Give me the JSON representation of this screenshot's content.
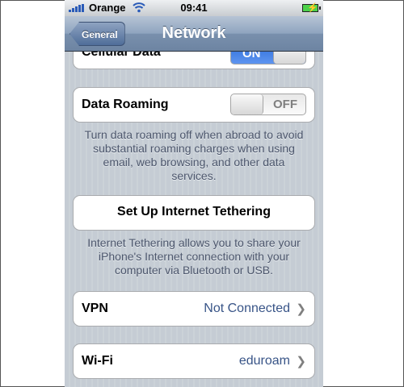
{
  "status": {
    "carrier": "Orange",
    "time": "09:41"
  },
  "nav": {
    "title": "Network",
    "back_label": "General"
  },
  "cellular": {
    "label": "Cellular Data",
    "toggle": "ON"
  },
  "roaming": {
    "label": "Data Roaming",
    "toggle": "OFF",
    "note": "Turn data roaming off when abroad to avoid substantial roaming charges when using email, web browsing, and other data services."
  },
  "tethering": {
    "label": "Set Up Internet Tethering",
    "note": "Internet Tethering allows you to share your iPhone's Internet connection with your computer via Bluetooth or USB."
  },
  "vpn": {
    "label": "VPN",
    "value": "Not Connected"
  },
  "wifi": {
    "label": "Wi-Fi",
    "value": "eduroam"
  },
  "colors": {
    "nav_bar": "#6d84a2",
    "value_text": "#385487",
    "switch_on": "#2f6ed9",
    "background": "#c5ccd4"
  }
}
